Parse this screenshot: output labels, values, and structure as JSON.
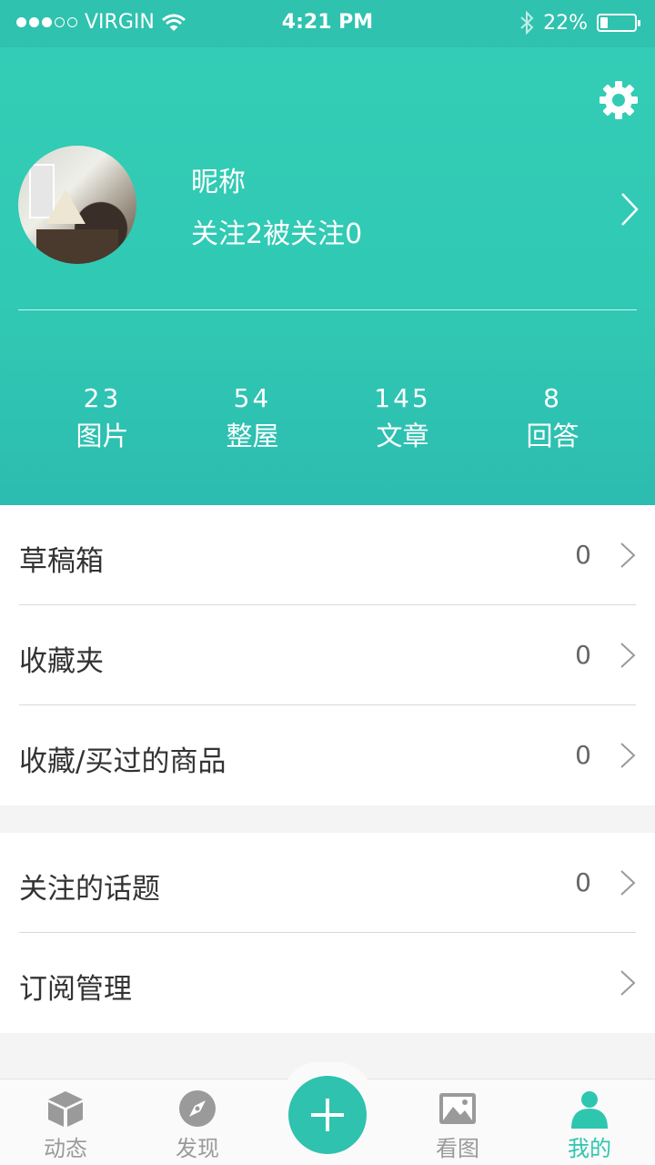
{
  "status_bar": {
    "carrier": "VIRGIN",
    "time": "4:21 PM",
    "battery": "22%",
    "battery_level": 0.22,
    "signal_bars": 3,
    "signal_total": 5
  },
  "profile": {
    "nickname": "昵称",
    "follow_text": "关注2被关注0"
  },
  "stats": [
    {
      "value": "23",
      "label": "图片"
    },
    {
      "value": "54",
      "label": "整屋"
    },
    {
      "value": "145",
      "label": "文章"
    },
    {
      "value": "8",
      "label": "回答"
    }
  ],
  "list1": [
    {
      "title": "草稿箱",
      "count": "0"
    },
    {
      "title": "收藏夹",
      "count": "0"
    },
    {
      "title": "收藏/买过的商品",
      "count": "0"
    }
  ],
  "list2": [
    {
      "title": "关注的话题",
      "count": "0"
    },
    {
      "title": "订阅管理",
      "count": ""
    }
  ],
  "tabs": [
    {
      "label": "动态",
      "icon": "cube-icon"
    },
    {
      "label": "发现",
      "icon": "compass-icon"
    },
    {
      "label": "看图",
      "icon": "image-icon"
    },
    {
      "label": "我的",
      "icon": "person-icon"
    }
  ],
  "colors": {
    "accent": "#2fc2ae",
    "tab_inactive": "#9a9a9a"
  }
}
